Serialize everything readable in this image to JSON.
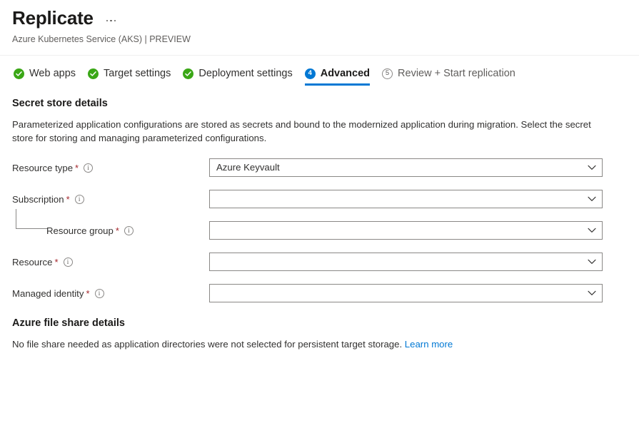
{
  "header": {
    "title": "Replicate",
    "subtitle": "Azure Kubernetes Service (AKS) | PREVIEW",
    "more_menu": "…"
  },
  "tabs": [
    {
      "label": "Web apps",
      "state": "done",
      "marker": "check"
    },
    {
      "label": "Target settings",
      "state": "done",
      "marker": "check"
    },
    {
      "label": "Deployment settings",
      "state": "done",
      "marker": "check"
    },
    {
      "label": "Advanced",
      "state": "active",
      "marker": "4"
    },
    {
      "label": "Review + Start replication",
      "state": "pending",
      "marker": "5"
    }
  ],
  "secret_store": {
    "title": "Secret store details",
    "description": "Parameterized application configurations are stored as secrets and bound to the modernized application during migration. Select the secret store for storing and managing parameterized configurations.",
    "fields": [
      {
        "label": "Resource type",
        "required": "*",
        "info": "i",
        "value": "Azure Keyvault",
        "indented": false
      },
      {
        "label": "Subscription",
        "required": "*",
        "info": "i",
        "value": "",
        "indented": false
      },
      {
        "label": "Resource group",
        "required": "*",
        "info": "i",
        "value": "",
        "indented": true
      },
      {
        "label": "Resource",
        "required": "*",
        "info": "i",
        "value": "",
        "indented": false
      },
      {
        "label": "Managed identity",
        "required": "*",
        "info": "i",
        "value": "",
        "indented": false
      }
    ]
  },
  "file_share": {
    "title": "Azure file share details",
    "note": "No file share needed as application directories were not selected for persistent target storage.",
    "link_label": "Learn more"
  },
  "colors": {
    "accent": "#0078d4",
    "success": "#3aa716",
    "required": "#a4262c",
    "border": "#8a8886",
    "text": "#323130",
    "muted": "#605e5c"
  }
}
